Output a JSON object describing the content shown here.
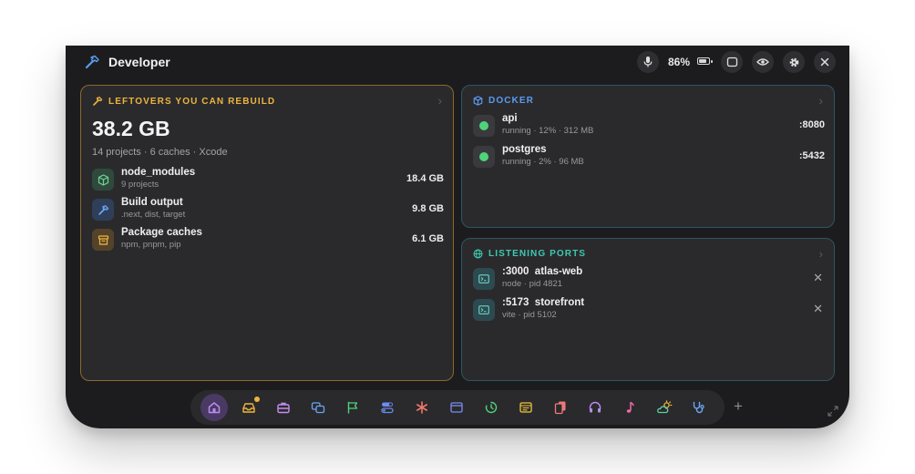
{
  "window": {
    "title": "Developer"
  },
  "status": {
    "battery_text": "86%",
    "battery_level": 0.86
  },
  "leftovers": {
    "header": "LEFTOVERS YOU CAN REBUILD",
    "total": "38.2 GB",
    "summary": "14 projects · 6 caches · Xcode",
    "items": [
      {
        "name": "node_modules",
        "detail": "9 projects",
        "size": "18.4 GB",
        "icon": "cube-icon"
      },
      {
        "name": "Build output",
        "detail": ".next, dist, target",
        "size": "9.8 GB",
        "icon": "hammer-icon"
      },
      {
        "name": "Package caches",
        "detail": "npm, pnpm, pip",
        "size": "6.1 GB",
        "icon": "archive-box-icon"
      }
    ]
  },
  "docker": {
    "header": "DOCKER",
    "containers": [
      {
        "name": "api",
        "detail": "running · 12% · 312 MB",
        "port": ":8080",
        "status_color": "#4fd37a"
      },
      {
        "name": "postgres",
        "detail": "running · 2% · 96 MB",
        "port": ":5432",
        "status_color": "#4fd37a"
      }
    ]
  },
  "ports": {
    "header": "LISTENING PORTS",
    "items": [
      {
        "name": ":3000  atlas-web",
        "detail": "node · pid 4821",
        "icon": "terminal-icon"
      },
      {
        "name": ":5173  storefront",
        "detail": "vite · pid 5102",
        "icon": "terminal-icon"
      }
    ]
  },
  "dock": {
    "items": [
      "home-icon",
      "inbox-tray-icon",
      "briefcase-icon",
      "windows-icon",
      "flag-icon",
      "toggles-icon",
      "asterisk-icon",
      "browser-window-icon",
      "timer-icon",
      "notes-icon",
      "cards-icon",
      "headphones-icon",
      "music-note-icon",
      "weather-icon",
      "stethoscope-icon"
    ],
    "active": "home-icon",
    "badged": "inbox-tray-icon"
  },
  "colors": {
    "leftovers_accent": "#f0b43c",
    "docker_accent": "#5a9cf0",
    "ports_accent": "#3fc9b0",
    "running": "#4fd37a"
  }
}
